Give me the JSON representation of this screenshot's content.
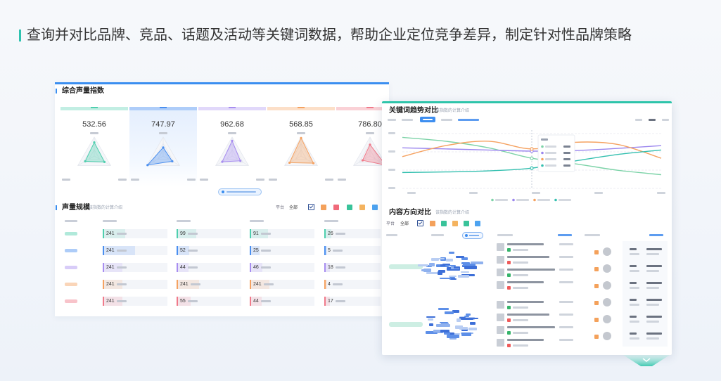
{
  "heading": "查询并对比品牌、竞品、话题及活动等关键词数据，帮助企业定位竞争差异，制定针对性品牌策略",
  "accent": {
    "teal": "#2fc3b0",
    "blue": "#3a8ef0"
  },
  "left_card": {
    "title": "综合声量指数",
    "metrics": [
      {
        "value": "532.56",
        "color": "#4fcfae",
        "radar": [
          0.72,
          0.55,
          0.62
        ]
      },
      {
        "value": "747.97",
        "color": "#4a8ff0",
        "radar": [
          0.45,
          0.95,
          0.55
        ],
        "selected": true
      },
      {
        "value": "962.68",
        "color": "#a88ef0",
        "radar": [
          0.8,
          0.6,
          0.5
        ]
      },
      {
        "value": "568.85",
        "color": "#f5a261",
        "radar": [
          0.95,
          0.7,
          0.75
        ]
      },
      {
        "value": "786.80",
        "color": "#f07a8a",
        "radar": [
          0.6,
          0.45,
          0.95
        ]
      }
    ],
    "scale": {
      "title": "声量规模",
      "subtitle": "该指数的计算介绍",
      "platform_label": "平台",
      "platform_value": "全部",
      "filter_colors": [
        "#f4a15b",
        "#f06a7a",
        "#39c39a",
        "#f4b35f",
        "#4da3f0"
      ],
      "rows": [
        {
          "color": "#4fcfae",
          "cells": [
            {
              "value": "241",
              "fill": 0.35
            },
            {
              "value": "99",
              "fill": 0.3
            },
            {
              "value": "91",
              "fill": 0.28
            },
            {
              "value": "26",
              "fill": 0.12
            }
          ]
        },
        {
          "color": "#4a8ff0",
          "cells": [
            {
              "value": "241",
              "fill": 0.5
            },
            {
              "value": "52",
              "fill": 0.2
            },
            {
              "value": "25",
              "fill": 0.15
            },
            {
              "value": "5",
              "fill": 0.05
            }
          ]
        },
        {
          "color": "#a88ef0",
          "cells": [
            {
              "value": "241",
              "fill": 0.3
            },
            {
              "value": "44",
              "fill": 0.18
            },
            {
              "value": "46",
              "fill": 0.2
            },
            {
              "value": "18",
              "fill": 0.1
            }
          ]
        },
        {
          "color": "#f5a261",
          "cells": [
            {
              "value": "241",
              "fill": 0.3
            },
            {
              "value": "241",
              "fill": 0.35
            },
            {
              "value": "241",
              "fill": 0.3
            },
            {
              "value": "4",
              "fill": 0.05
            }
          ]
        },
        {
          "color": "#f07a8a",
          "cells": [
            {
              "value": "241",
              "fill": 0.3
            },
            {
              "value": "55",
              "fill": 0.22
            },
            {
              "value": "44",
              "fill": 0.18
            },
            {
              "value": "17",
              "fill": 0.1
            }
          ]
        }
      ]
    }
  },
  "right_card": {
    "trend": {
      "title": "关键词趋势对比",
      "subtitle": "该指数的计算介绍",
      "series": [
        {
          "color": "#7dd3a8",
          "levels": [
            0.93,
            0.86,
            0.74,
            0.55,
            0.45,
            0.33,
            0.25
          ]
        },
        {
          "color": "#9b86ee",
          "levels": [
            0.74,
            0.72,
            0.7,
            0.68,
            0.69,
            0.73,
            0.78
          ]
        },
        {
          "color": "#f5a261",
          "levels": [
            0.58,
            0.78,
            0.86,
            0.72,
            0.84,
            0.8,
            0.55
          ]
        },
        {
          "color": "#35c0b0",
          "levels": [
            0.29,
            0.3,
            0.32,
            0.37,
            0.5,
            0.62,
            0.7
          ]
        }
      ]
    },
    "content": {
      "title": "内容方向对比",
      "subtitle": "该指数的计算介绍",
      "platform_label": "平台",
      "platform_value": "全部",
      "filter_colors": [
        "#f4a15b",
        "#39c39a",
        "#f4b35f",
        "#39c39a",
        "#4da3f0"
      ]
    }
  },
  "icons": [
    "checkbox-icon",
    "search-icon",
    "scroll-down-icon"
  ]
}
